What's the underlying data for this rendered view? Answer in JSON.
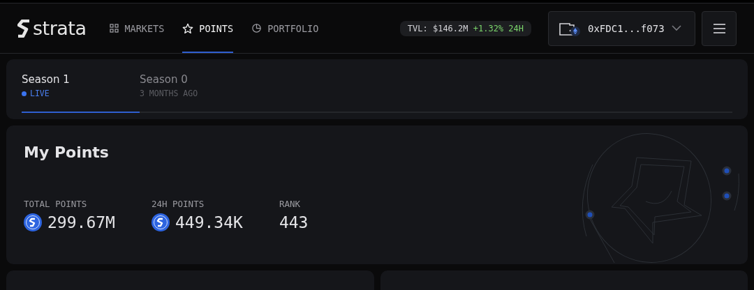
{
  "header": {
    "logo": "strata",
    "nav": [
      {
        "label": "MARKETS",
        "kind": "grid",
        "selected": false
      },
      {
        "label": "POINTS",
        "kind": "star",
        "selected": true
      },
      {
        "label": "PORTFOLIO",
        "kind": "pie",
        "selected": false
      }
    ],
    "tvl": {
      "label": "TVL: $146.2M",
      "change": "+1.32% 24H"
    },
    "wallet": {
      "address": "0xFDC1...f073"
    }
  },
  "seasons": [
    {
      "name": "Season 1",
      "status": "LIVE",
      "live": true,
      "selected": true
    },
    {
      "name": "Season 0",
      "status": "3 MONTHS AGO",
      "live": false,
      "selected": false
    }
  ],
  "my_points": {
    "title": "My Points",
    "stats": [
      {
        "label": "TOTAL POINTS",
        "value": "299.67M",
        "token": true
      },
      {
        "label": "24H POINTS",
        "value": "449.34K",
        "token": true
      },
      {
        "label": "RANK",
        "value": "443",
        "token": false
      }
    ]
  }
}
